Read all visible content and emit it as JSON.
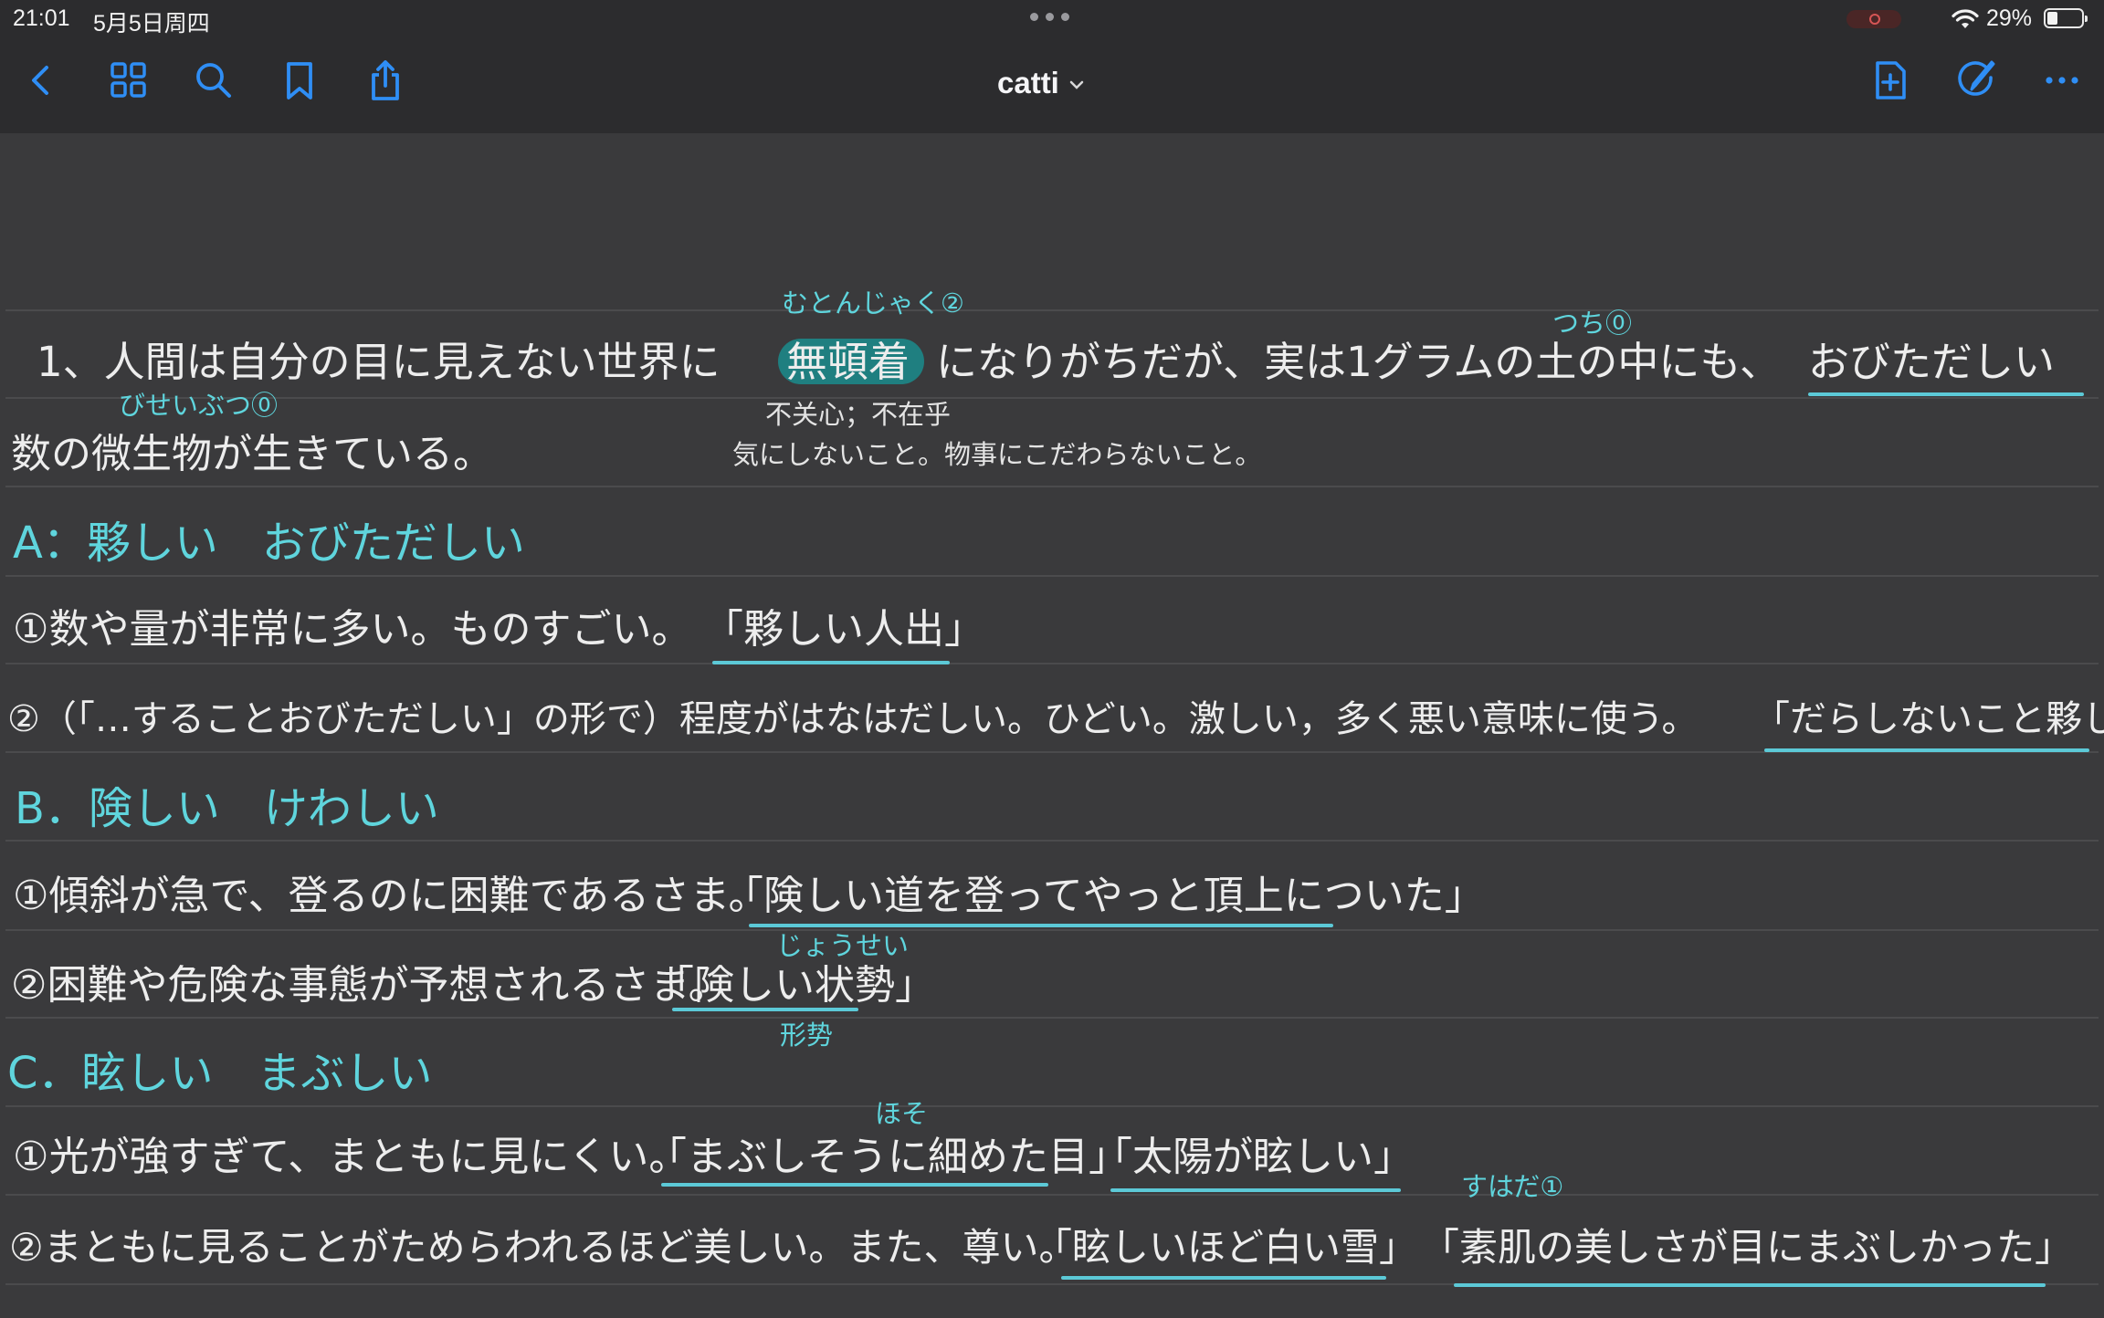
{
  "status": {
    "time": "21:01",
    "date": "5月5日周四",
    "battery": "29%"
  },
  "toolbar": {
    "title": "catti",
    "icons": [
      "back-chevron-icon",
      "grid-icon",
      "search-icon",
      "bookmark-icon",
      "share-icon",
      "add-page-icon",
      "markup-pencil-icon",
      "more-icon"
    ]
  },
  "colors": {
    "accent": "#2f8ef5",
    "ink": "#ededed",
    "teal_ink": "#5fd5dd",
    "underline": "#5cc9d7",
    "highlight": "#1f7f80",
    "background": "#3a3a3c"
  },
  "note": {
    "reading_mutonjaku": "むとんじゃく②",
    "reading_tsuchi": "つち⓪",
    "s1_pre": "1、人間は自分の目に見えない世界に",
    "s1_hl": "無頓着",
    "s1_post": "になりがちだが、実は1グラムの土の中にも、",
    "s1_ul": "おびただしい",
    "reading_biseibutsu": "びせいぶつ⓪",
    "gloss_1": "不关心；不在乎",
    "s1_line2": "数の微生物が生きている。",
    "gloss_2": "気にしないこと。物事にこだわらないこと。",
    "head_a": "A：夥しい　おびただしい",
    "a1_pre": "①数や量が非常に多い。ものすごい。",
    "a1_ul": "「夥しい人出」",
    "a2_pre": "②（「…することおびただしい」の形で）程度がはなはだしい。ひどい。激しい，多く悪い意味に使う。",
    "a2_ul": "「だらしないこと夥しい」",
    "head_b": "B．険しい　けわしい",
    "b1_pre": "①傾斜が急で、登るのに困難であるさま。",
    "b1_ul": "「険しい道を登ってやっと頂上についた」",
    "reading_jousei": "じょうせい",
    "b2_pre": "②困難や危険な事態が予想されるさま。",
    "b2_ul": "「険しい状勢」",
    "gloss_3": "形势",
    "head_c": "C．眩しい　まぶしい",
    "reading_hoso": "ほそ",
    "c1_pre": "①光が強すぎて、まともに見にくい。",
    "c1_ul1": "「まぶしそうに細めた目」",
    "c1_ul2": "「太陽が眩しい」",
    "reading_suhada": "すはだ①",
    "c2_pre": "②まともに見ることがためらわれるほど美しい。また、尊い。",
    "c2_ul1": "「眩しいほど白い雪」",
    "c2_ul2": "「素肌の美しさが目にまぶしかった」"
  }
}
